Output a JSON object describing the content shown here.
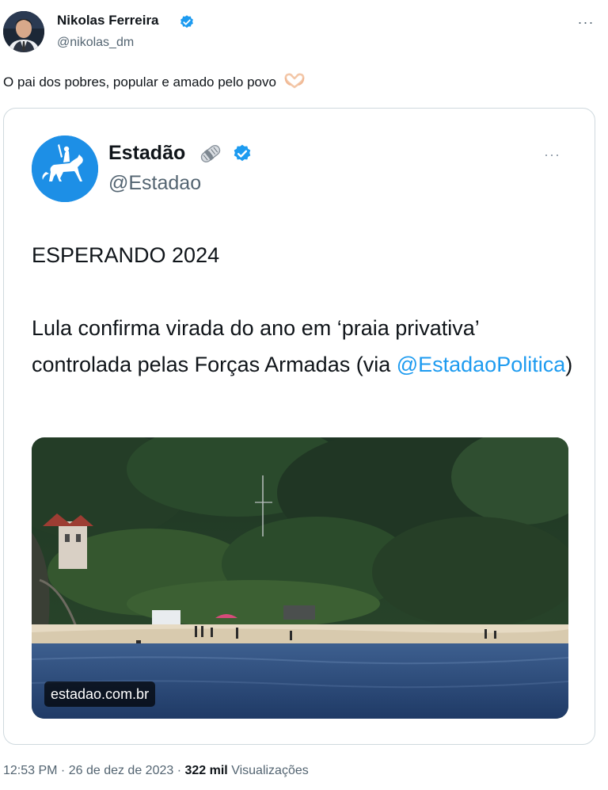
{
  "author": {
    "name": "Nikolas Ferreira",
    "handle": "@nikolas_dm",
    "avatar_icon": "profile-photo",
    "verified_color": "#1d9bf0"
  },
  "more_label": "···",
  "tweet": {
    "text": "O pai dos pobres, popular e amado pelo povo",
    "emoji_icon": "heart-hands-emoji"
  },
  "quote": {
    "name": "Estadão",
    "handle": "@Estadao",
    "more_label": "···",
    "news_icon": "rolled-newspaper-emoji",
    "headline": "ESPERANDO 2024",
    "body_before_link": "Lula confirma virada do ano em ‘praia privativa’ controlada pelas Forças Armadas (via ",
    "link": "@EstadaoPolitica",
    "body_after_link": ")",
    "media_badge": "estadao.com.br"
  },
  "meta": {
    "time": "12:53 PM",
    "separator": " · ",
    "date": "26 de dez de 2023",
    "views_count": "322 mil",
    "views_label": "Visualizações"
  },
  "colors": {
    "link": "#1d9bf0",
    "secondary_text": "#536471",
    "brand_estadao": "#1d8fe6"
  }
}
